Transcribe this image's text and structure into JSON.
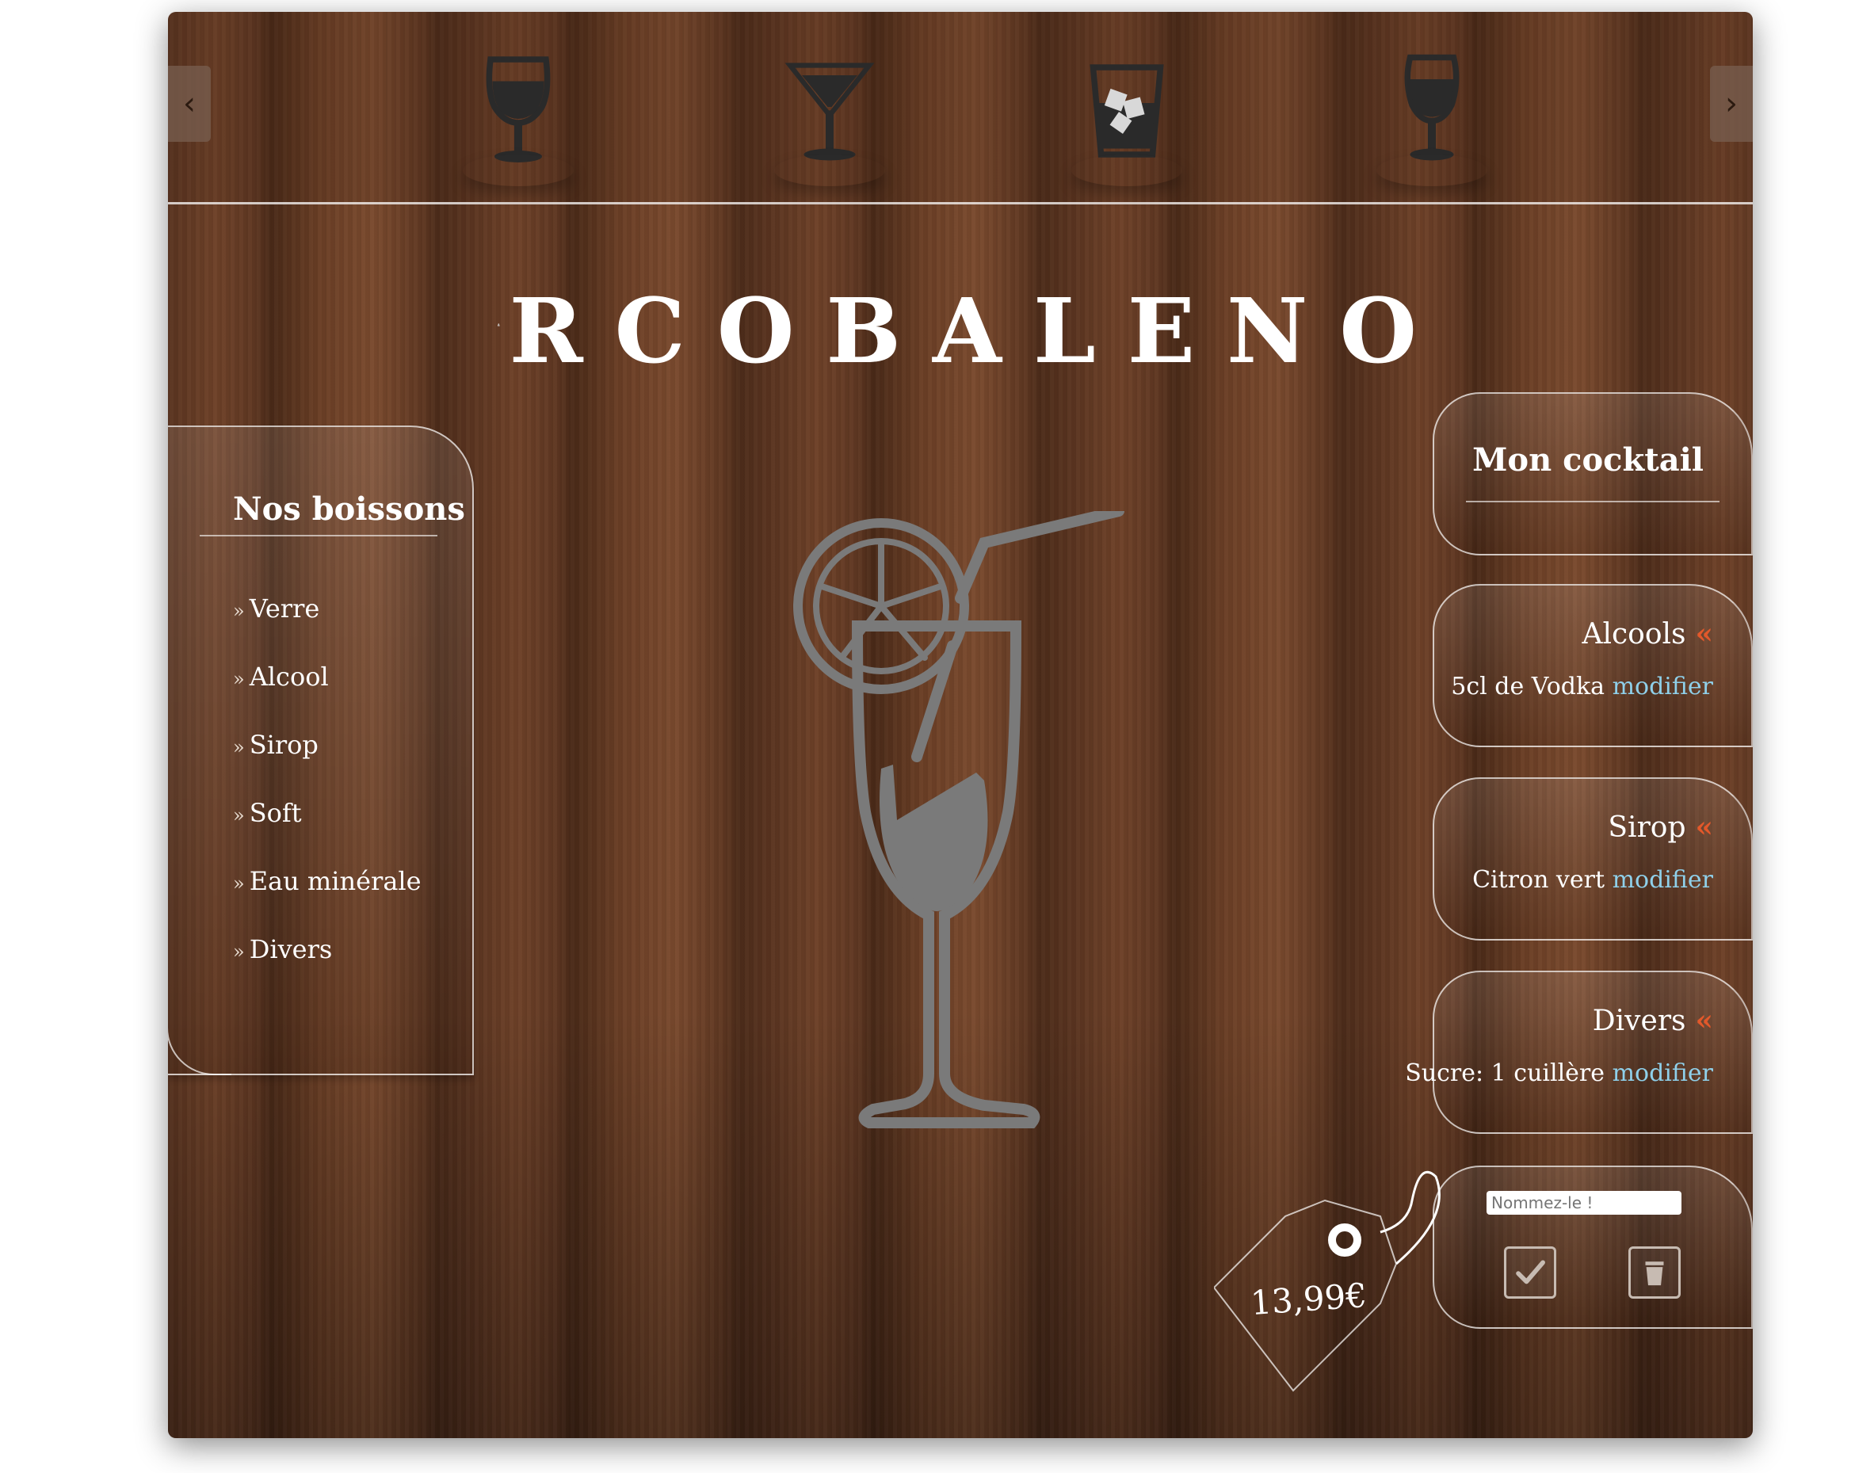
{
  "carousel": {
    "prev_label": "‹",
    "next_label": "›",
    "glasses": [
      {
        "name": "wine-glass-icon"
      },
      {
        "name": "martini-glass-icon"
      },
      {
        "name": "whisky-glass-icon"
      },
      {
        "name": "tulip-glass-icon"
      }
    ]
  },
  "brand": {
    "logo_letters": "RCOBALENO"
  },
  "sidebar": {
    "title": "Nos boissons",
    "bullet": "»",
    "items": [
      {
        "label": "Verre"
      },
      {
        "label": "Alcool"
      },
      {
        "label": "Sirop"
      },
      {
        "label": "Soft"
      },
      {
        "label": "Eau minérale"
      },
      {
        "label": "Divers"
      }
    ]
  },
  "cocktail": {
    "title": "Mon cocktail",
    "back_symbol": "«",
    "modify_label": "modifier",
    "categories": [
      {
        "title": "Alcools",
        "value": "5cl de Vodka"
      },
      {
        "title": "Sirop",
        "value": "Citron vert"
      },
      {
        "title": "Divers",
        "value": "Sucre: 1 cuillère"
      }
    ],
    "name_placeholder": "Nommez-le !",
    "price": "13,99€"
  },
  "colors": {
    "accent": "#e2582a",
    "link": "#8fd0ea",
    "text": "#ffffff"
  }
}
